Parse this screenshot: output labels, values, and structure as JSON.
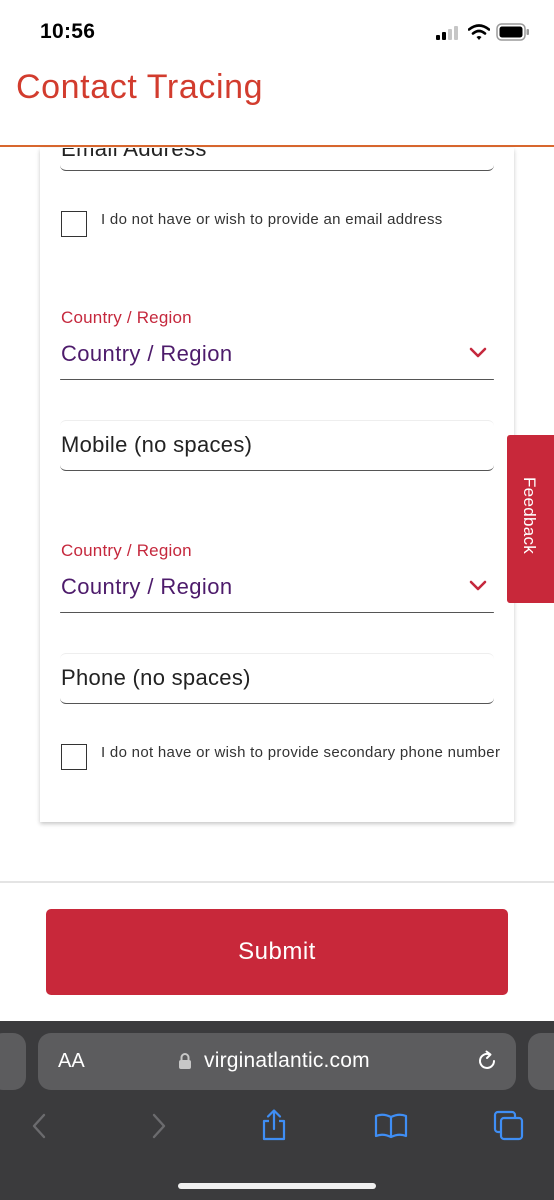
{
  "status_bar": {
    "time": "10:56"
  },
  "header": {
    "title": "Contact Tracing"
  },
  "form": {
    "email_label_cut": "Email Address",
    "email_opt_out_label": "I do not have or wish to provide an email address",
    "mobile_country": {
      "label": "Country / Region",
      "value": "Country / Region"
    },
    "mobile_placeholder": "Mobile (no spaces)",
    "phone_country": {
      "label": "Country / Region",
      "value": "Country / Region"
    },
    "phone_placeholder": "Phone (no spaces)",
    "secondary_phone_opt_out_label": "I do not have or wish to provide secondary phone number"
  },
  "feedback_tab": {
    "label": "Feedback"
  },
  "submit": {
    "label": "Submit"
  },
  "browser": {
    "text_size_label": "AA",
    "url": "virginatlantic.com"
  },
  "colors": {
    "brand_red": "#c8283a",
    "title_red": "#d23c2e",
    "header_rule": "#d8672e",
    "select_value_purple": "#4d1b6b",
    "browser_bar": "#3b3b3d",
    "toolbar_icon_blue": "#3f8ef5"
  },
  "icons": [
    "signal-icon",
    "wifi-icon",
    "battery-icon",
    "chevron-down-icon",
    "lock-icon",
    "reload-icon",
    "back-icon",
    "forward-icon",
    "share-icon",
    "bookmarks-icon",
    "tabs-icon"
  ]
}
